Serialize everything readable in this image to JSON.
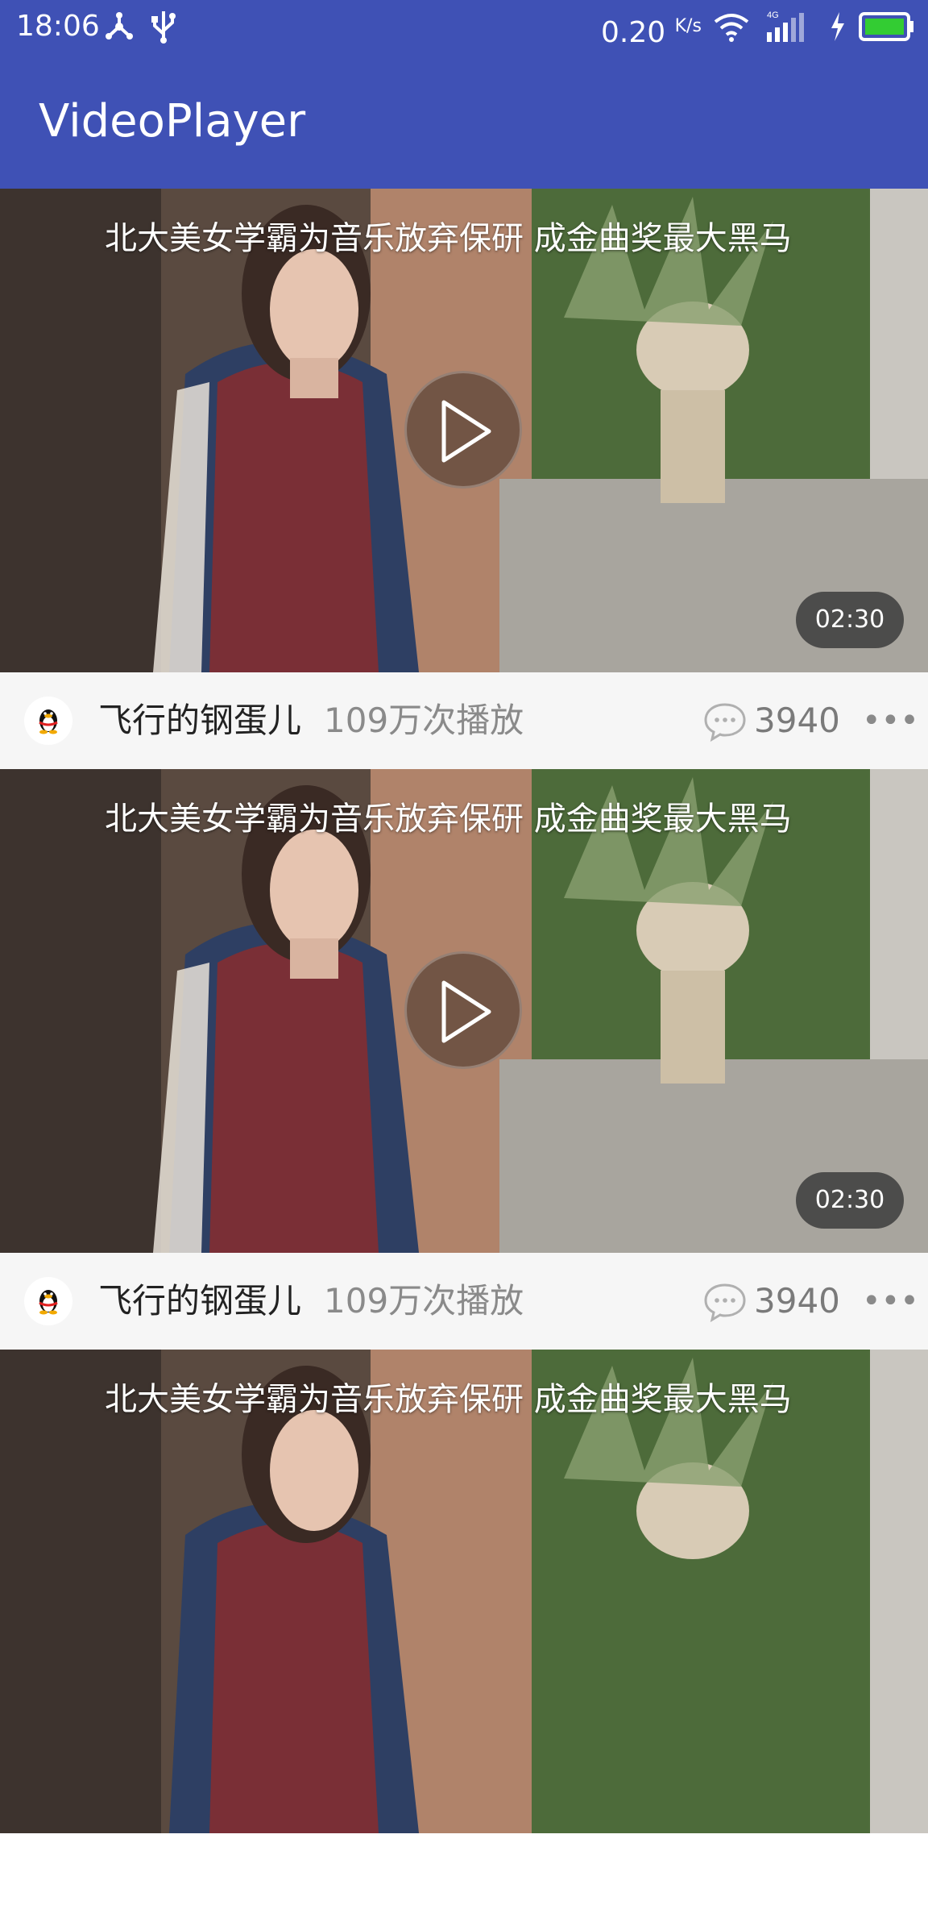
{
  "status_bar": {
    "time": "18:06",
    "net_speed": "0.20",
    "net_speed_unit": "K/s",
    "network_type": "4G",
    "icons": [
      "usb-debug-icon",
      "usb-icon",
      "wifi-icon",
      "cell-signal-icon",
      "charging-icon",
      "battery-icon"
    ]
  },
  "app_bar": {
    "title": "VideoPlayer"
  },
  "feed": {
    "items": [
      {
        "title": "北大美女学霸为音乐放弃保研 成金曲奖最大黑马",
        "duration": "02:30",
        "author": "飞行的钢蛋儿",
        "plays": "109万次播放",
        "comments": "3940",
        "more": "•••"
      },
      {
        "title": "北大美女学霸为音乐放弃保研 成金曲奖最大黑马",
        "duration": "02:30",
        "author": "飞行的钢蛋儿",
        "plays": "109万次播放",
        "comments": "3940",
        "more": "•••"
      },
      {
        "title": "北大美女学霸为音乐放弃保研 成金曲奖最大黑马"
      }
    ]
  },
  "colors": {
    "primary": "#3f51b5",
    "meta_background": "#f6f6f6",
    "battery_level": "#33cc33"
  }
}
